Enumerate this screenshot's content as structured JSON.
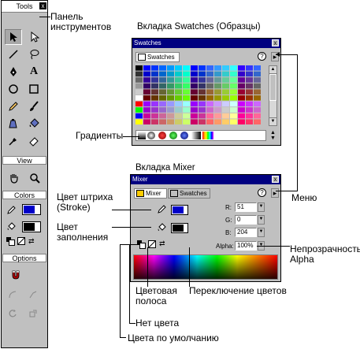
{
  "toolbox": {
    "title": "Tools",
    "close": "x",
    "view_label": "View",
    "colors_label": "Colors",
    "options_label": "Options"
  },
  "swatches_panel": {
    "heading": "Вкладка Swatches (Образцы)",
    "title": "Swatches",
    "tab": "Swatches",
    "close": "x",
    "help": "?",
    "menu": "▸",
    "colors": {
      "stroke": "#0000c8",
      "fill": "#000000",
      "accent": "#000080"
    }
  },
  "mixer_panel": {
    "heading": "Вкладка Mixer",
    "title": "Mixer",
    "tab_mixer": "Mixer",
    "tab_swatches": "Swatches",
    "close": "x",
    "help": "?",
    "menu": "▸",
    "r_label": "R:",
    "g_label": "G:",
    "b_label": "B:",
    "r_value": "51",
    "g_value": "0",
    "b_value": "204",
    "alpha_label": "Alpha:",
    "alpha_value": "100%"
  },
  "annotations": {
    "toolbar": "Панель инструментов",
    "gradients": "Градиенты",
    "stroke_color": "Цвет штриха (Stroke)",
    "fill_color": "Цвет заполнения",
    "menu": "Меню",
    "opacity": "Непрозрачность Alpha",
    "color_bar": "Цветовая полоса",
    "swap_colors": "Переключение цветов",
    "no_color": "Нет цвета",
    "default_colors": "Цвета по умолчанию"
  }
}
